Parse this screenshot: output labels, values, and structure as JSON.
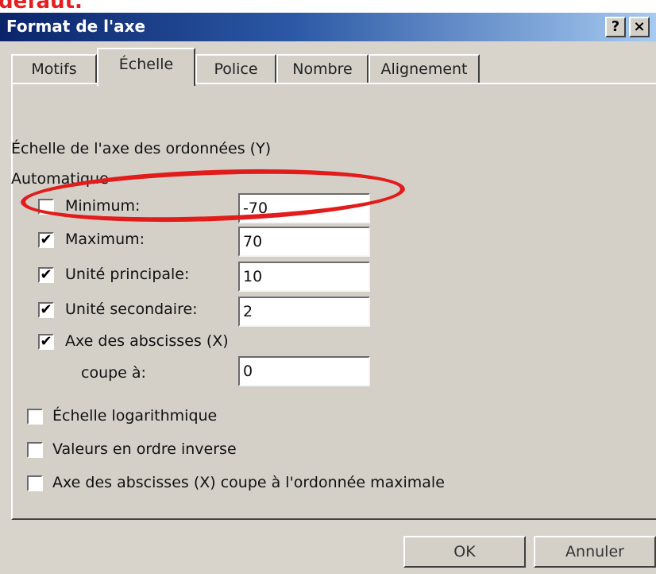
{
  "header": {
    "caption": "défaut."
  },
  "window": {
    "title": "Format de l'axe",
    "help_label": "?",
    "close_label": "×"
  },
  "tabs": [
    {
      "label": "Motifs"
    },
    {
      "label": "Échelle",
      "active": true
    },
    {
      "label": "Police"
    },
    {
      "label": "Nombre"
    },
    {
      "label": "Alignement"
    }
  ],
  "scale": {
    "heading": "Échelle de l'axe des ordonnées (Y)",
    "auto_label": "Automatique",
    "rows": [
      {
        "label": "Minimum:",
        "checked": false,
        "value": "-70"
      },
      {
        "label": "Maximum:",
        "checked": true,
        "value": "70"
      },
      {
        "label": "Unité principale:",
        "checked": true,
        "value": "10"
      },
      {
        "label": "Unité secondaire:",
        "checked": true,
        "value": "2"
      }
    ],
    "cross_axis": {
      "label": "Axe des abscisses (X)",
      "checked": true
    },
    "cross_at": {
      "label": "coupe à:",
      "value": "0"
    },
    "options": [
      {
        "label": "Échelle logarithmique",
        "checked": false
      },
      {
        "label": "Valeurs en ordre inverse",
        "checked": false
      },
      {
        "label": "Axe des abscisses (X) coupe à l'ordonnée maximale",
        "checked": false
      }
    ]
  },
  "buttons": {
    "ok": "OK",
    "cancel": "Annuler"
  },
  "check_glyph": "✔",
  "colors": {
    "annotation": "#e21b1b",
    "title_bar": "#0a246a"
  }
}
